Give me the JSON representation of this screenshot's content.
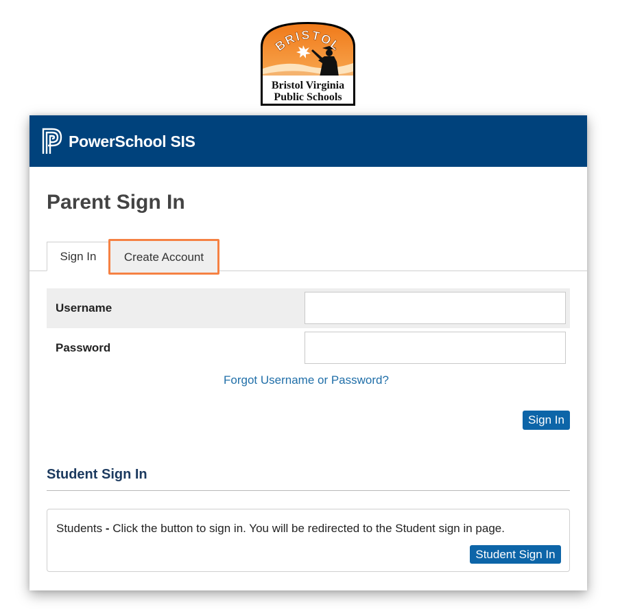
{
  "logo": {
    "top_text": "BRISTOL",
    "line1": "Bristol Virginia",
    "line2": "Public Schools"
  },
  "banner": {
    "title": "PowerSchool SIS"
  },
  "page_title": "Parent Sign In",
  "tabs": [
    {
      "label": "Sign In",
      "active": true
    },
    {
      "label": "Create Account",
      "active": false,
      "highlighted": true
    }
  ],
  "form": {
    "username_label": "Username",
    "username_value": "",
    "password_label": "Password",
    "password_value": "",
    "forgot_link": "Forgot Username or Password?",
    "submit_label": "Sign In"
  },
  "student": {
    "heading": "Student Sign In",
    "prefix": "Students",
    "separator": " - ",
    "message": "Click the button to sign in. You will be redirected to the Student sign in page.",
    "button_label": "Student Sign In"
  },
  "colors": {
    "banner": "#00427c",
    "button": "#0d65a8",
    "link": "#1f6ea8",
    "highlight": "#f58143"
  }
}
